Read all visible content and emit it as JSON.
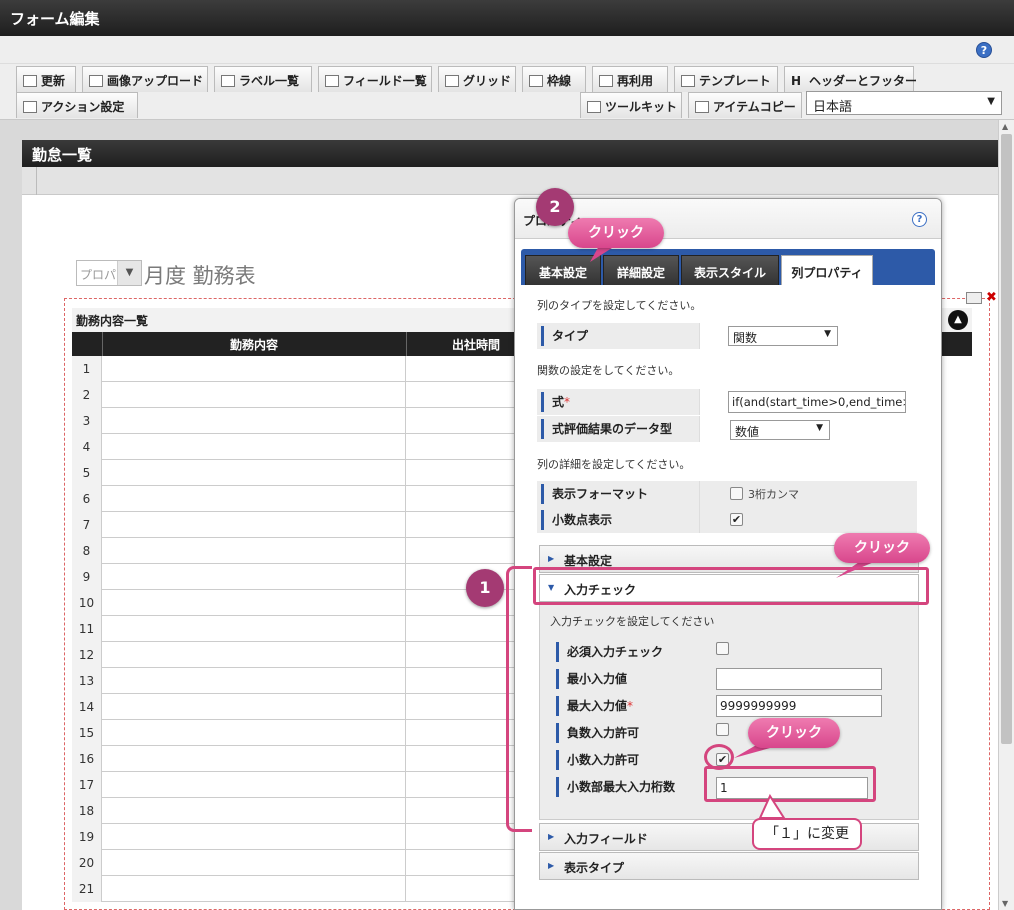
{
  "app": {
    "title": "フォーム編集"
  },
  "toolbar": {
    "buttons": [
      {
        "label": "更新",
        "icon": "refresh-icon"
      },
      {
        "label": "画像アップロード",
        "icon": "image-upload-icon"
      },
      {
        "label": "ラベル一覧",
        "icon": "label-list-icon"
      },
      {
        "label": "フィールド一覧",
        "icon": "field-list-icon"
      },
      {
        "label": "グリッド",
        "icon": "grid-icon"
      },
      {
        "label": "枠線",
        "icon": "border-icon"
      },
      {
        "label": "再利用",
        "icon": "reuse-icon"
      },
      {
        "label": "テンプレート",
        "icon": "template-icon"
      },
      {
        "label": "ヘッダーとフッター",
        "icon": "header-footer-icon"
      }
    ],
    "row2": [
      {
        "label": "アクション設定",
        "icon": "action-icon"
      },
      {
        "label": "ツールキット",
        "icon": "toolkit-icon"
      },
      {
        "label": "アイテムコピー",
        "icon": "item-copy-icon"
      }
    ],
    "language": "日本語",
    "letter_h": "H"
  },
  "form": {
    "header": "勤怠一覧",
    "proto_select": "プロパ",
    "month_title": "月度 勤務表",
    "table_title": "勤務内容一覧",
    "columns": [
      "勤務内容",
      "出社時間"
    ],
    "rows": [
      "1",
      "2",
      "3",
      "4",
      "5",
      "6",
      "7",
      "8",
      "9",
      "10",
      "11",
      "12",
      "13",
      "14",
      "15",
      "16",
      "17",
      "18",
      "19",
      "20",
      "21"
    ]
  },
  "dialog": {
    "title": "プロパティ",
    "tabs": [
      "基本設定",
      "詳細設定",
      "表示スタイル",
      "列プロパティ"
    ],
    "active_tab": 3,
    "instr_type": "列のタイプを設定してください。",
    "type_label": "タイプ",
    "type_value": "関数",
    "instr_func": "関数の設定をしてください。",
    "formula_label": "式",
    "formula_value": "if(and(start_time>0,end_time>0",
    "datatype_label": "式評価結果のデータ型",
    "datatype_value": "数値",
    "instr_detail": "列の詳細を設定してください。",
    "format_label": "表示フォーマット",
    "format_option": "3桁カンマ",
    "decimal_label": "小数点表示",
    "accordion": {
      "basic": "基本設定",
      "input_check": "入力チェック",
      "input_field": "入力フィールド",
      "display_type": "表示タイプ"
    },
    "input_check": {
      "instr": "入力チェックを設定してください",
      "required": "必須入力チェック",
      "min": "最小入力値",
      "min_value": "",
      "max": "最大入力値",
      "max_value": "9999999999",
      "negative": "負数入力許可",
      "decimal_allow": "小数入力許可",
      "decimal_digits": "小数部最大入力桁数",
      "decimal_digits_value": "1"
    },
    "asterisk": "*"
  },
  "annotations": {
    "badge1": "1",
    "badge2": "2",
    "click": "クリック",
    "note": "「１」に変更"
  },
  "glyphs": {
    "help": "?",
    "down": "▼",
    "up": "▲",
    "right": "▶",
    "check": "✔",
    "close": "✖"
  },
  "colors": {
    "accent_pink": "#d4457e",
    "badge": "#a43a73",
    "tab_blue": "#2d5aa8"
  }
}
